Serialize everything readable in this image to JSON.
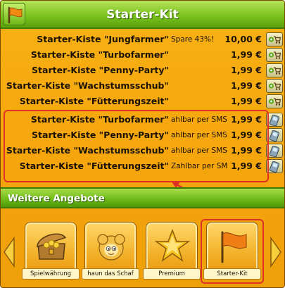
{
  "header": {
    "title": "Starter-Kit",
    "icon": "flag-icon"
  },
  "rows": [
    {
      "name": "Starter-Kiste \"Jungfarmer\"",
      "note": "Spare 43%!",
      "price": "10,00 €",
      "action": "cart"
    },
    {
      "name": "Starter-Kiste \"Turbofarmer\"",
      "note": "",
      "price": "1,99 €",
      "action": "cart"
    },
    {
      "name": "Starter-Kiste \"Penny-Party\"",
      "note": "",
      "price": "1,99 €",
      "action": "cart"
    },
    {
      "name": "Starter-Kiste \"Wachstumsschub\"",
      "note": "",
      "price": "1,99 €",
      "action": "cart"
    },
    {
      "name": "Starter-Kiste \"Fütterungszeit\"",
      "note": "",
      "price": "1,99 €",
      "action": "cart"
    },
    {
      "name": "Starter-Kiste \"Turbofarmer\"",
      "note": "ahlbar per SMS",
      "price": "1,99 €",
      "action": "sms"
    },
    {
      "name": "Starter-Kiste \"Penny-Party\"",
      "note": "ahlbar per SMS",
      "price": "1,99 €",
      "action": "sms"
    },
    {
      "name": "Starter-Kiste \"Wachstumsschub\"",
      "note": "ahlbar per SMS",
      "price": "1,99 €",
      "action": "sms"
    },
    {
      "name": "Starter-Kiste \"Fütterungszeit\"",
      "note": "Zahlbar per SMS",
      "price": "1,99 €",
      "action": "sms"
    }
  ],
  "offers": {
    "title": "Weitere Angebote",
    "items": [
      {
        "label": "Spielwährung",
        "icon": "treasure-chest-icon"
      },
      {
        "label": "haun das Schaf",
        "icon": "sheep-icon"
      },
      {
        "label": "Premium",
        "icon": "star-icon"
      },
      {
        "label": "Starter-Kit",
        "icon": "flag-icon",
        "selected": true
      }
    ]
  },
  "colors": {
    "panel": "#f5a50c",
    "header_green": "#7cc41d",
    "highlight_red": "#e03124"
  }
}
